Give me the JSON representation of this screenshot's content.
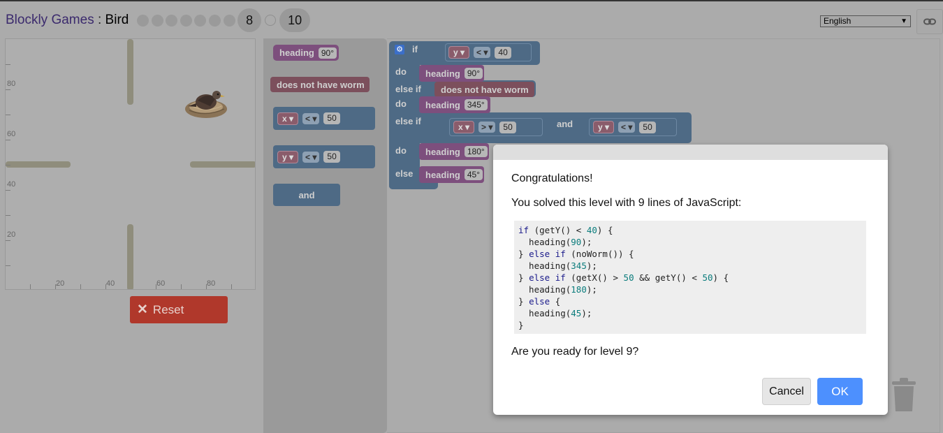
{
  "header": {
    "app_name": "Blockly Games",
    "separator": " : ",
    "game_name": "Bird",
    "levels_completed": [
      "1",
      "2",
      "3",
      "4",
      "5",
      "6",
      "7"
    ],
    "current_level": "8",
    "last_level": "10",
    "language": "English"
  },
  "visual": {
    "y_labels": [
      "80",
      "60",
      "40",
      "20"
    ],
    "x_labels": [
      "20",
      "40",
      "60",
      "80"
    ]
  },
  "controls": {
    "reset_label": "Reset"
  },
  "toolbox": {
    "heading_label": "heading",
    "heading_value": "90°",
    "no_worm_label": "does not have worm",
    "cmp_x_var": "x",
    "cmp_x_op": "<",
    "cmp_x_val": "50",
    "cmp_y_var": "y",
    "cmp_y_op": "<",
    "cmp_y_val": "50",
    "and_label": "and"
  },
  "program": {
    "if_label": "if",
    "do_label": "do",
    "else_if_label": "else if",
    "else_label": "else",
    "cond1": {
      "var": "y",
      "op": "<",
      "val": "40"
    },
    "do1": {
      "label": "heading",
      "val": "90°"
    },
    "cond2_label": "does not have worm",
    "do2": {
      "label": "heading",
      "val": "345°"
    },
    "cond3a": {
      "var": "x",
      "op": ">",
      "val": "50"
    },
    "and_label": "and",
    "cond3b": {
      "var": "y",
      "op": "<",
      "val": "50"
    },
    "do3": {
      "label": "heading",
      "val": "180°"
    },
    "do4": {
      "label": "heading",
      "val": "45°"
    }
  },
  "dialog": {
    "title": "Congratulations!",
    "message": "You solved this level with 9 lines of JavaScript:",
    "code_lines": [
      "if (getY() < 40) {",
      "  heading(90);",
      "} else if (noWorm()) {",
      "  heading(345);",
      "} else if (getX() > 50 && getY() < 50) {",
      "  heading(180);",
      "} else {",
      "  heading(45);",
      "}"
    ],
    "question": "Are you ready for level 9?",
    "cancel_label": "Cancel",
    "ok_label": "OK"
  },
  "colors": {
    "reset": "#b0382b",
    "ok": "#4d90fe",
    "heading_block": "#7d4f7d",
    "sensor_block": "#7c4f5c",
    "logic_block": "#4e6a85"
  }
}
